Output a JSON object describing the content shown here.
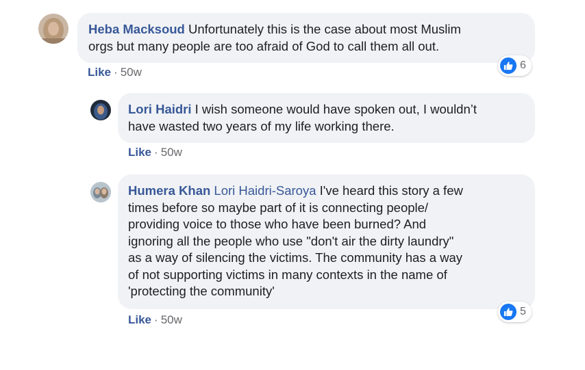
{
  "comments": [
    {
      "author": "Heba Macksoud",
      "text_lines": [
        "Unfortunately this is the case about most Muslim",
        "orgs but many people are too afraid of God to call them all out."
      ],
      "like_label": "Like",
      "separator": "·",
      "time": "50w",
      "reaction_count": "6",
      "avatar_colors": {
        "bg": "#c9b7a4",
        "scarf": "#b89a7a",
        "face": "#d9b8a0"
      }
    },
    {
      "author": "Lori Haidri",
      "text_lines": [
        "I wish someone would have spoken out, I wouldn’t",
        "have wasted two years of my life working there."
      ],
      "like_label": "Like",
      "separator": "·",
      "time": "50w",
      "avatar_colors": {
        "bg": "#1f2a3a",
        "scarf": "#3a5a8a",
        "face": "#c59a7e"
      }
    },
    {
      "author": "Humera Khan",
      "mention": "Lori Haidri-Saroya",
      "text_lines": [
        "I've heard this story a few",
        "times before so maybe part of it is connecting people/",
        "providing voice to those who have been burned? And",
        "ignoring all the people who use \"don't air the dirty laundry\"",
        "as a way of silencing the victims. The community has a way",
        "of not supporting victims in many contexts in the name of",
        "'protecting the community'"
      ],
      "like_label": "Like",
      "separator": "·",
      "time": "50w",
      "reaction_count": "5",
      "avatar_colors": {
        "bg": "#b8c4cc",
        "scarf": "#7a8a96",
        "face": "#d4b49c"
      }
    }
  ],
  "colors": {
    "author": "#385898",
    "bubble": "#f0f2f5",
    "like_badge": "#1877f2",
    "meta": "#65676b"
  }
}
